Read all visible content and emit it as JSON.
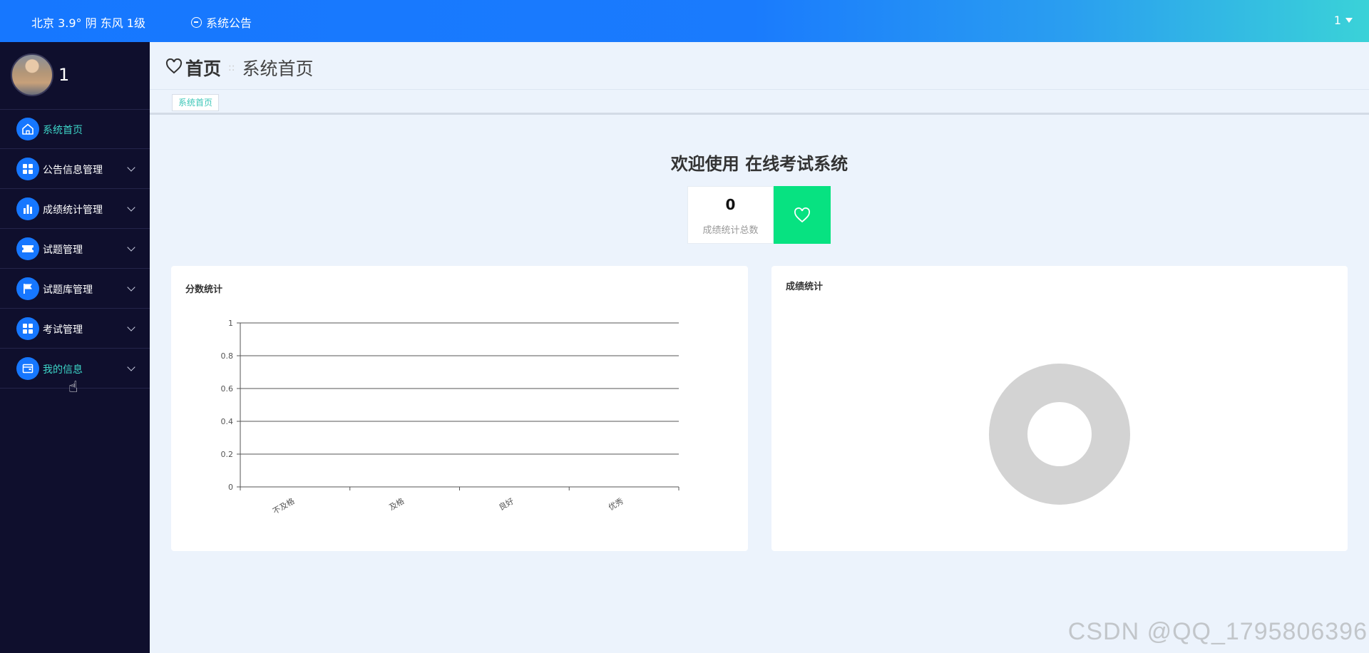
{
  "topbar": {
    "weather": "北京  3.9°  阴  东风  1级",
    "notice_label": "系统公告",
    "user_label": "1"
  },
  "sidebar": {
    "username": "1",
    "items": [
      {
        "label": "系统首页",
        "icon": "home-icon",
        "active": true
      },
      {
        "label": "公告信息管理",
        "icon": "grid-icon"
      },
      {
        "label": "成绩统计管理",
        "icon": "bar-chart-icon"
      },
      {
        "label": "试题管理",
        "icon": "ticket-icon"
      },
      {
        "label": "试题库管理",
        "icon": "flag-icon"
      },
      {
        "label": "考试管理",
        "icon": "grid-icon"
      },
      {
        "label": "我的信息",
        "icon": "wallet-icon"
      }
    ]
  },
  "breadcrumb": {
    "home": "首页",
    "separator": "::",
    "current": "系统首页"
  },
  "tabs": [
    "系统首页"
  ],
  "welcome": "欢迎使用 在线考试系统",
  "stat": {
    "value": "0",
    "label": "成绩统计总数"
  },
  "panels": {
    "left_title": "分数统计",
    "right_title": "成绩统计"
  },
  "chart_data": [
    {
      "type": "bar",
      "title": "分数统计",
      "categories": [
        "不及格",
        "及格",
        "良好",
        "优秀"
      ],
      "values": [
        0,
        0,
        0,
        0
      ],
      "ylim": [
        0,
        1
      ],
      "yticks": [
        "0",
        "0.2",
        "0.4",
        "0.6",
        "0.8",
        "1"
      ],
      "grid": true
    },
    {
      "type": "pie",
      "title": "成绩统计",
      "labels": [],
      "values": [],
      "style": "donut-empty"
    }
  ],
  "colors": {
    "accent": "#1677ff",
    "sidebar_bg": "#0f0f2d",
    "active_text": "#3dd6c8",
    "stat_green": "#07e281",
    "donut_gray": "#d3d3d3"
  },
  "watermark": "CSDN @QQ_1795806396"
}
